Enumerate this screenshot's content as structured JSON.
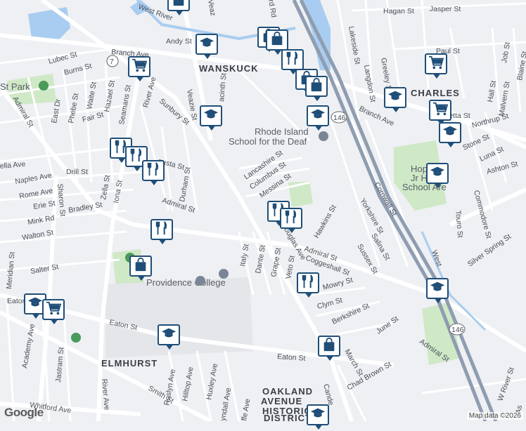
{
  "map": {
    "areas": {
      "wanskuck": "WANSKUCK",
      "charles": "CHARLES",
      "elmhurst": "ELMHURST",
      "oakland_1": "OAKLAND",
      "oakland_2": "AVENUE",
      "oakland_3": "HISTORIC",
      "oakland_4": "DISTRICT"
    },
    "pois": {
      "school_deaf_1": "Rhode Island",
      "school_deaf_2": "School for the Deaf",
      "providence_college": "Providence College",
      "st_park": "St Park",
      "hopkins_1": "Hopkins",
      "hopkins_2": "Jr High",
      "hopkins_3": "School Are",
      "west_river": "West River"
    },
    "roads": {
      "admiral_st_w": "Admiral St",
      "admiral_st_mid": "Admiral St",
      "admiral_st_e": "Admiral St",
      "admiral_st_se": "Admiral St",
      "branch_ave_w": "Branch Ave",
      "branch_ave_e": "Branch Ave",
      "eaton_st_w": "Eaton St",
      "eaton_st_mid": "Eaton St",
      "eaton_st_e": "Eaton St",
      "douglas_ave": "Douglas Ave",
      "veazie_st": "Veazie St",
      "veazie_st_n": "Veaz",
      "river_ave_n": "River Ave",
      "river_ave_s": "River Ave",
      "sharon_st": "Sharon St",
      "smith_st": "Smith St",
      "whitford_ave": "Whitford Ave",
      "lubec_st": "Lubec St",
      "burns_st": "Burns St",
      "east_dr": "East Dr",
      "phebe_st": "Phebe St",
      "waite_st": "Waite St",
      "hazael_st": "Hazael St",
      "seamans_st": "Seamans St",
      "fair_st": "Fair St",
      "sunbury_st": "Sunbury St",
      "drill_st": "Drill St",
      "naples_ave": "Naples Ave",
      "rome_ave": "Rome Ave",
      "erie_st": "Erie St",
      "bradley_st": "Bradley St",
      "mink_rd": "Mink Rd",
      "walton_st": "Walton St",
      "salter_st": "Salter St",
      "zella_st": "Zella St",
      "iona_st": "Iona St",
      "durham_st": "Durham St",
      "stella_ave": "ella Ave",
      "augusta_st": "gusta St",
      "hyacinth_st": "acinth St",
      "andy_st": "Andy St",
      "lancashire_st": "Lancashire St",
      "columbus_st": "Columbus St",
      "messina_st": "Messina St",
      "hawkins_st": "Hawkins St",
      "italy_st": "Italy St",
      "dante_st": "Dante St",
      "grape_st": "Grape St",
      "veto_st": "Veto St",
      "coggeshall_st": "Coggeshall St",
      "mowry_st": "Mowry St",
      "clym_st": "Clym St",
      "berkshire_st": "Berkshire St",
      "june_st": "June St",
      "march_st": "March St",
      "chad_brown_st": "Chad Brown St",
      "yorkshire_st": "Yorkshire St",
      "cornwall_st": "Cornwall St",
      "salina_st": "Salina St",
      "sussex_st": "Sussex St",
      "hagan_st": "Hagan St",
      "jasper_st": "Jasper St",
      "paul_st": "Paul St",
      "job_st": "Job St",
      "blaine_st": "Blaine St",
      "lakeside_st": "Lakeside St",
      "langdon_st": "Langdon St",
      "greeley_st": "Greeley St",
      "hall_st": "Hall St",
      "malvern_st": "Malvern St",
      "ethrop_st": "Northrup St",
      "stone_st": "Stone St",
      "luna_st": "Luna St",
      "ashton_st": "Ashton St",
      "touro_st": "Touro St",
      "commodore_st": "Commodore St",
      "silver_spring_st": "Silver Spring St",
      "w_river_st": "W River St",
      "roslyn_ave": "Roslyn Ave",
      "hilltop_ave": "Hilltop Ave",
      "huxley_ave": "Huxley Ave",
      "tyndall_ave": "yndall Ave",
      "radcliffe_ave": "ffe Ave",
      "camden": "Cande",
      "meridian_st": "Meridian St",
      "academy_ave": "Academy Ave",
      "jastram_st": "Jastram St",
      "west_river_st": "West",
      "henrietta_st": "ietta St",
      "as_cut": "As",
      "ward_rd": "rd Rd",
      "route_7": "7",
      "route_146_n": "146",
      "route_146_s": "146"
    },
    "attribution": "Map data ©2026",
    "logo": "Google"
  },
  "markers": [
    {
      "type": "shopping",
      "icon": "shopping-bag-icon"
    },
    {
      "type": "school",
      "icon": "graduation-cap-icon"
    },
    {
      "type": "shopping",
      "icon": "shopping-bag-icon"
    },
    {
      "type": "shopping",
      "icon": "shopping-bag-icon"
    },
    {
      "type": "restaurant",
      "icon": "fork-knife-icon"
    },
    {
      "type": "shopping",
      "icon": "shopping-bag-icon"
    },
    {
      "type": "shopping",
      "icon": "shopping-bag-icon"
    },
    {
      "type": "school",
      "icon": "graduation-cap-icon"
    },
    {
      "type": "grocery",
      "icon": "shopping-cart-icon"
    },
    {
      "type": "school",
      "icon": "graduation-cap-icon"
    },
    {
      "type": "grocery",
      "icon": "shopping-cart-icon"
    },
    {
      "type": "grocery",
      "icon": "shopping-cart-icon"
    },
    {
      "type": "school",
      "icon": "graduation-cap-icon"
    },
    {
      "type": "school",
      "icon": "graduation-cap-icon"
    },
    {
      "type": "school",
      "icon": "graduation-cap-icon"
    },
    {
      "type": "restaurant",
      "icon": "fork-knife-icon"
    },
    {
      "type": "restaurant",
      "icon": "fork-knife-icon"
    },
    {
      "type": "restaurant",
      "icon": "fork-knife-icon"
    },
    {
      "type": "restaurant",
      "icon": "fork-knife-icon"
    },
    {
      "type": "restaurant",
      "icon": "fork-knife-icon"
    },
    {
      "type": "restaurant",
      "icon": "fork-knife-icon"
    },
    {
      "type": "shopping",
      "icon": "shopping-bag-icon"
    },
    {
      "type": "restaurant",
      "icon": "fork-knife-icon"
    },
    {
      "type": "school",
      "icon": "graduation-cap-icon"
    },
    {
      "type": "school",
      "icon": "graduation-cap-icon"
    },
    {
      "type": "grocery",
      "icon": "shopping-cart-icon"
    },
    {
      "type": "school",
      "icon": "graduation-cap-icon"
    },
    {
      "type": "shopping",
      "icon": "shopping-bag-icon"
    },
    {
      "type": "school",
      "icon": "graduation-cap-icon"
    }
  ],
  "colors": {
    "marker_border": "#1f4e78",
    "park": "#cfe8c6",
    "water": "#a9cdf0",
    "highway": "#8f9db1",
    "road": "#ffffff"
  }
}
